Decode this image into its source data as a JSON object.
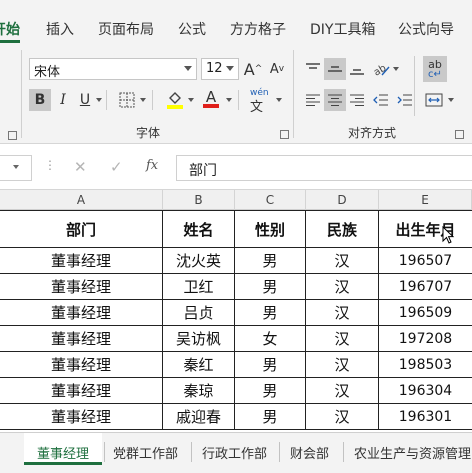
{
  "ribbon": {
    "tabs": [
      "开始",
      "插入",
      "页面布局",
      "公式",
      "方方格子",
      "DIY工具箱",
      "公式向导"
    ],
    "font_name": "宋体",
    "font_size": "12",
    "grow_font_label": "A",
    "shrink_font_label": "A",
    "bold_label": "B",
    "italic_label": "I",
    "underline_label": "U",
    "font_color_label": "A",
    "phonetic_label": "wén",
    "font_group_label": "字体",
    "align_group_label": "对齐方式",
    "wrap_label": "ab",
    "accent_green": "#1e6f3e"
  },
  "formula_bar": {
    "value": "部门",
    "function_icon_label": "fx"
  },
  "sheet": {
    "columns": [
      "A",
      "B",
      "C",
      "D",
      "E"
    ],
    "headers": [
      "部门",
      "姓名",
      "性别",
      "民族",
      "出生年月"
    ],
    "rows": [
      [
        "董事经理",
        "沈火英",
        "男",
        "汉",
        "196507"
      ],
      [
        "董事经理",
        "卫红",
        "男",
        "汉",
        "196707"
      ],
      [
        "董事经理",
        "吕贞",
        "男",
        "汉",
        "196509"
      ],
      [
        "董事经理",
        "吴访枫",
        "女",
        "汉",
        "197208"
      ],
      [
        "董事经理",
        "秦红",
        "男",
        "汉",
        "198503"
      ],
      [
        "董事经理",
        "秦琼",
        "男",
        "汉",
        "196304"
      ],
      [
        "董事经理",
        "戚迎春",
        "男",
        "汉",
        "196301"
      ]
    ]
  },
  "sheet_tabs": [
    "董事经理",
    "党群工作部",
    "行政工作部",
    "财会部",
    "农业生产与资源管理"
  ]
}
